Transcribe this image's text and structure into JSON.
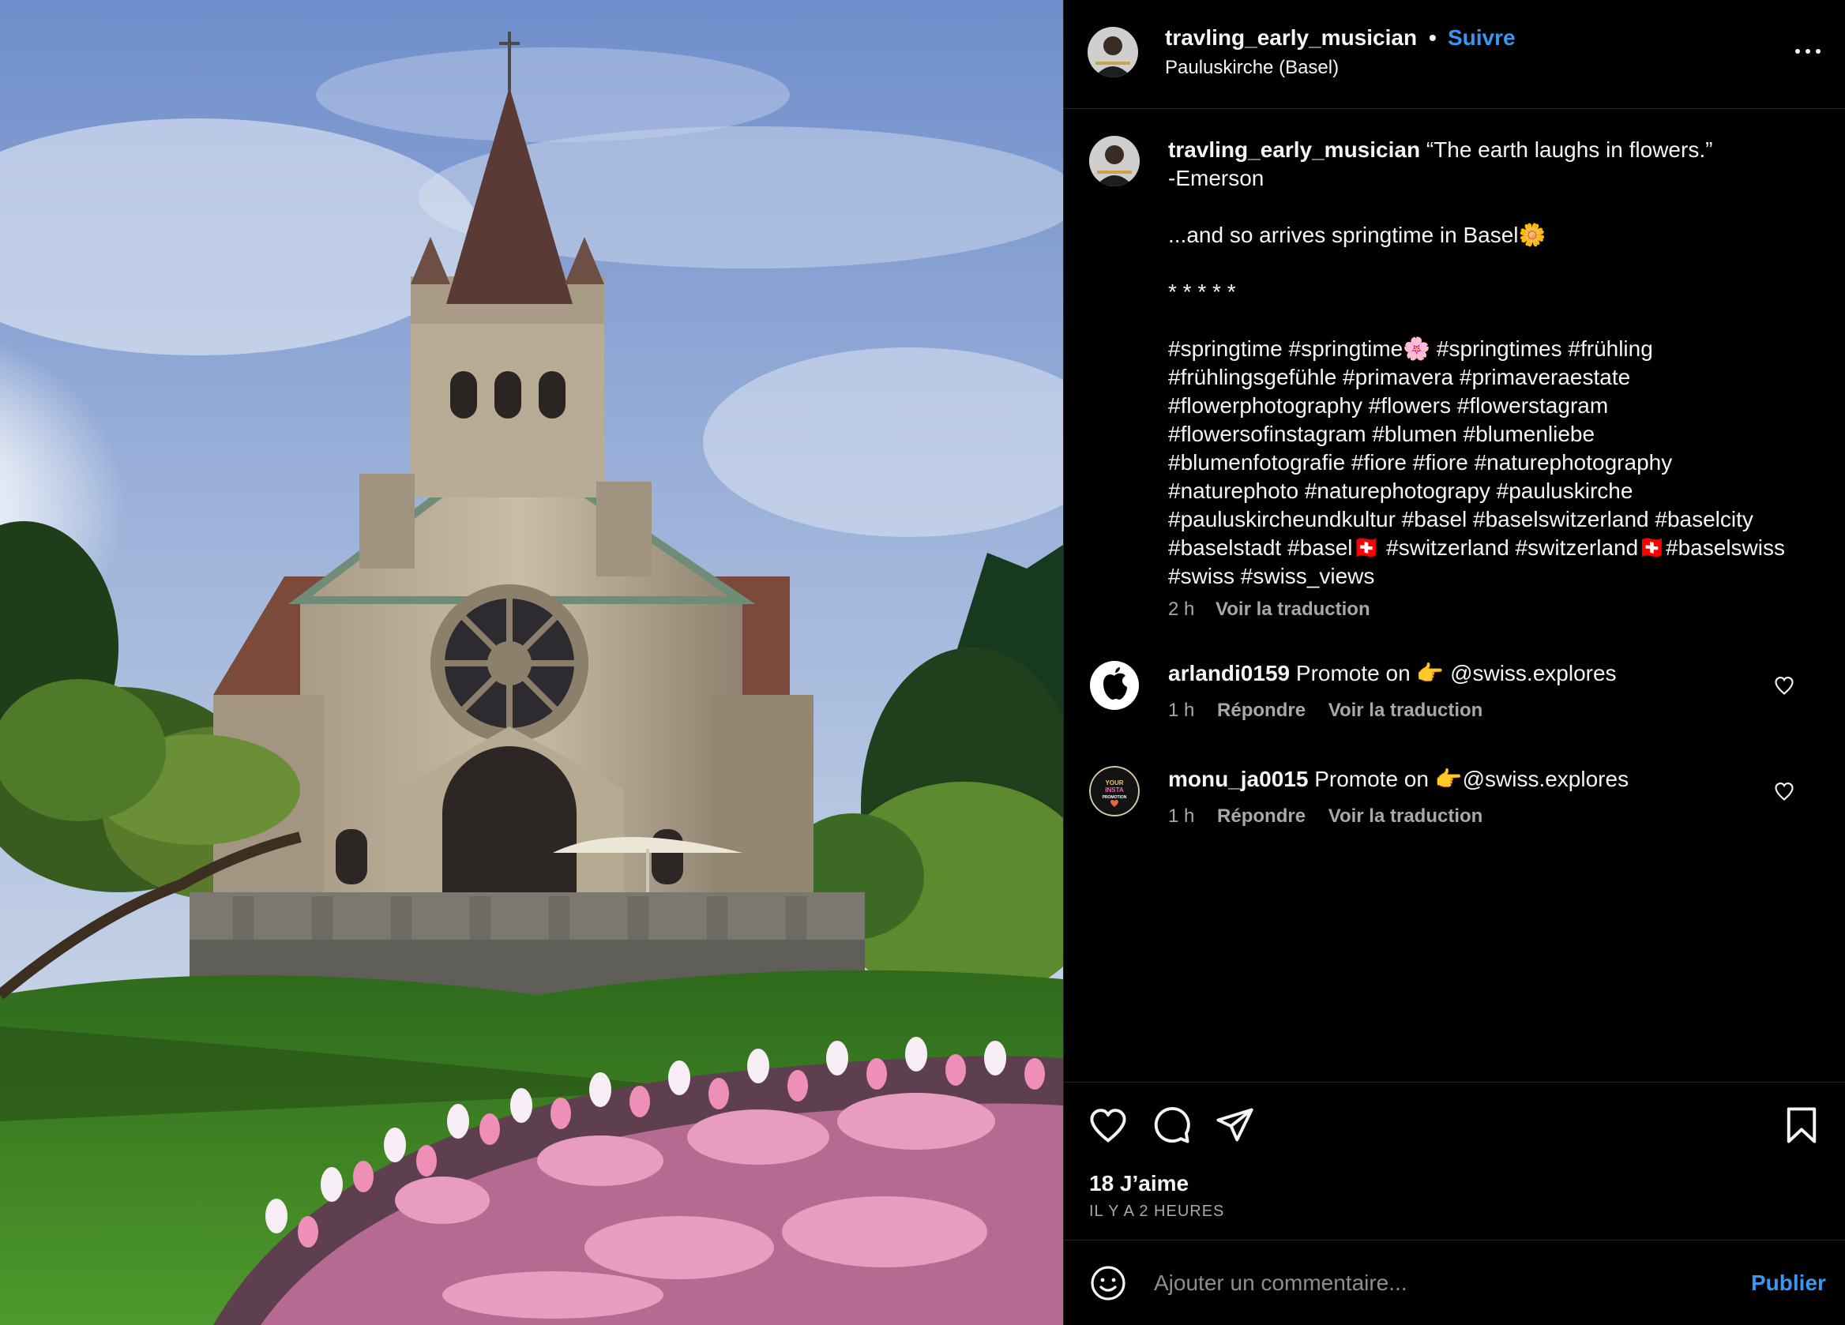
{
  "post": {
    "username": "travling_early_musician",
    "separator": "•",
    "follow_label": "Suivre",
    "location": "Pauluskirche (Basel)"
  },
  "caption": {
    "username": "travling_early_musician",
    "text": " “The earth laughs in flowers.”\n-Emerson\n\n...and so arrives springtime in Basel🌼\n\n* * * * *\n\n#springtime #springtime🌸 #springtimes #frühling\n#frühlingsgefühle #primavera #primaveraestate\n#flowerphotography #flowers #flowerstagram\n#flowersofinstagram #blumen #blumenliebe\n#blumenfotografie #fiore #fiore #naturephotography\n#naturephoto #naturephotograpy #pauluskirche\n#pauluskircheundkultur #basel #baselswitzerland #baselcity\n#baselstadt #basel🇨🇭 #switzerland #switzerland🇨🇭#baselswiss\n#swiss #swiss_views",
    "time": "2 h",
    "translate": "Voir la traduction"
  },
  "comments": [
    {
      "username": "arlandi0159",
      "text": "Promote on 👉 ",
      "mention": "@swiss.explores",
      "time": "1 h",
      "reply": "Répondre",
      "translate": "Voir la traduction",
      "avatar_icon": "apple-logo-icon"
    },
    {
      "username": "monu_ja0015",
      "text": "Promote on 👉",
      "mention": "@swiss.explores",
      "time": "1 h",
      "reply": "Répondre",
      "translate": "Voir la traduction",
      "avatar_icon": "promo-badge-icon",
      "avatar_text": [
        "YOUR",
        "INSTA",
        "PROMOTION"
      ]
    }
  ],
  "actions": {
    "likes": "18 J’aime",
    "time_ago": "IL Y A 2 HEURES",
    "icons": [
      "heart-icon",
      "comment-icon",
      "share-icon",
      "bookmark-icon"
    ]
  },
  "add_comment": {
    "placeholder": "Ajouter un commentaire...",
    "publish_label": "Publier"
  },
  "colors": {
    "background": "#000000",
    "text": "#f5f5f5",
    "secondary_text": "#a8a8a8",
    "link_blue": "#3897f0",
    "divider": "#262626"
  }
}
